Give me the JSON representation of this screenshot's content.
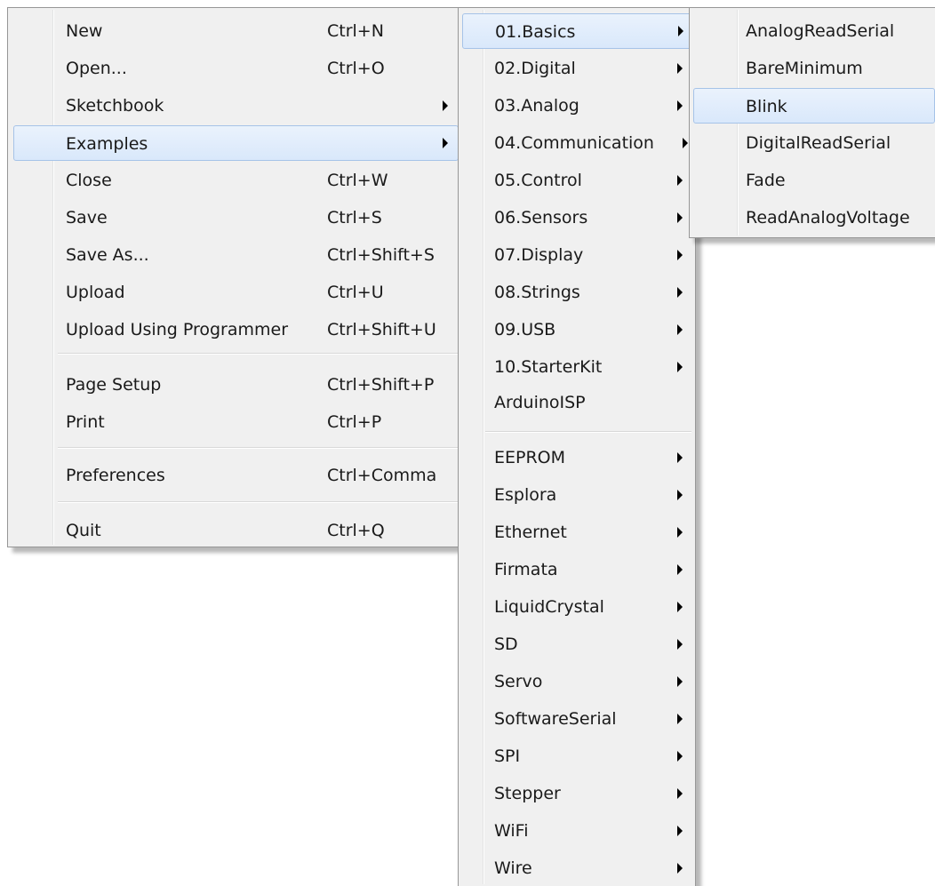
{
  "file_menu": {
    "items": [
      {
        "label": "New",
        "shortcut": "Ctrl+N"
      },
      {
        "label": "Open...",
        "shortcut": "Ctrl+O"
      },
      {
        "label": "Sketchbook",
        "shortcut": ""
      },
      {
        "label": "Examples",
        "shortcut": ""
      },
      {
        "label": "Close",
        "shortcut": "Ctrl+W"
      },
      {
        "label": "Save",
        "shortcut": "Ctrl+S"
      },
      {
        "label": "Save As...",
        "shortcut": "Ctrl+Shift+S"
      },
      {
        "label": "Upload",
        "shortcut": "Ctrl+U"
      },
      {
        "label": "Upload Using Programmer",
        "shortcut": "Ctrl+Shift+U"
      },
      {
        "label": "Page Setup",
        "shortcut": "Ctrl+Shift+P"
      },
      {
        "label": "Print",
        "shortcut": "Ctrl+P"
      },
      {
        "label": "Preferences",
        "shortcut": "Ctrl+Comma"
      },
      {
        "label": "Quit",
        "shortcut": "Ctrl+Q"
      }
    ]
  },
  "examples_menu": {
    "items": [
      {
        "label": "01.Basics"
      },
      {
        "label": "02.Digital"
      },
      {
        "label": "03.Analog"
      },
      {
        "label": "04.Communication"
      },
      {
        "label": "05.Control"
      },
      {
        "label": "06.Sensors"
      },
      {
        "label": "07.Display"
      },
      {
        "label": "08.Strings"
      },
      {
        "label": "09.USB"
      },
      {
        "label": "10.StarterKit"
      },
      {
        "label": "ArduinoISP"
      },
      {
        "label": "EEPROM"
      },
      {
        "label": "Esplora"
      },
      {
        "label": "Ethernet"
      },
      {
        "label": "Firmata"
      },
      {
        "label": "LiquidCrystal"
      },
      {
        "label": "SD"
      },
      {
        "label": "Servo"
      },
      {
        "label": "SoftwareSerial"
      },
      {
        "label": "SPI"
      },
      {
        "label": "Stepper"
      },
      {
        "label": "WiFi"
      },
      {
        "label": "Wire"
      }
    ]
  },
  "basics_menu": {
    "items": [
      {
        "label": "AnalogReadSerial"
      },
      {
        "label": "BareMinimum"
      },
      {
        "label": "Blink"
      },
      {
        "label": "DigitalReadSerial"
      },
      {
        "label": "Fade"
      },
      {
        "label": "ReadAnalogVoltage"
      }
    ]
  }
}
